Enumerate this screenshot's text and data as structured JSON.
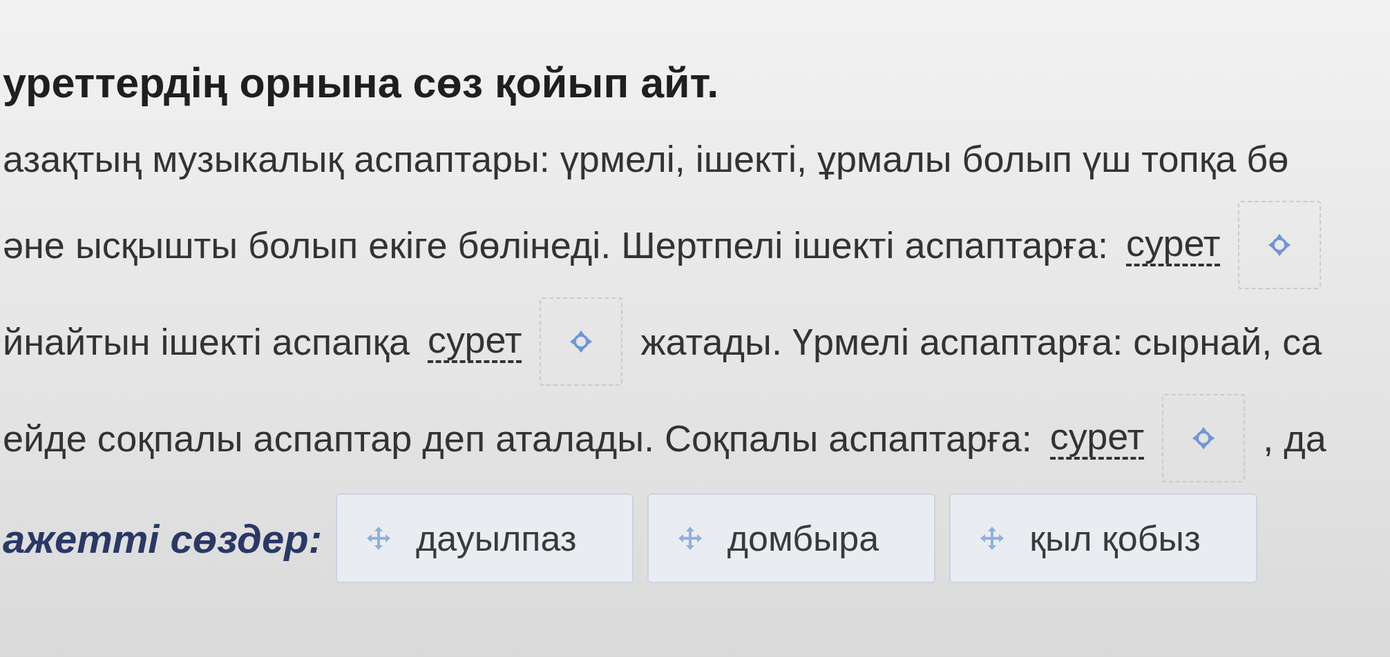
{
  "title": "уреттердің орнына сөз қойып айт.",
  "text_lines": [
    {
      "segments": [
        {
          "kind": "text",
          "text": "азақтың музыкалық аспаптары: үрмелі, ішекті, ұрмалы болып үш топқа бө"
        }
      ]
    },
    {
      "segments": [
        {
          "kind": "text",
          "text": "әне ысқышты болып екіге бөлінеді. Шертпелі ішекті аспаптарға:"
        },
        {
          "kind": "picture_link",
          "text": "сурет"
        },
        {
          "kind": "drop_zone"
        }
      ]
    },
    {
      "segments": [
        {
          "kind": "text",
          "text": "йнайтын ішекті аспапқа"
        },
        {
          "kind": "picture_link",
          "text": "сурет"
        },
        {
          "kind": "drop_zone"
        },
        {
          "kind": "text",
          "text": "жатады. Үрмелі аспаптарға: сырнай, са"
        }
      ]
    },
    {
      "segments": [
        {
          "kind": "text",
          "text": "ейде соқпалы аспаптар деп аталады. Соқпалы аспаптарға:"
        },
        {
          "kind": "picture_link",
          "text": "сурет"
        },
        {
          "kind": "drop_zone"
        },
        {
          "kind": "text",
          "text": ", да"
        }
      ]
    }
  ],
  "word_bank": {
    "label": "ажетті сөздер:",
    "words": [
      "дауылпаз",
      "домбыра",
      "қыл қобыз"
    ]
  }
}
